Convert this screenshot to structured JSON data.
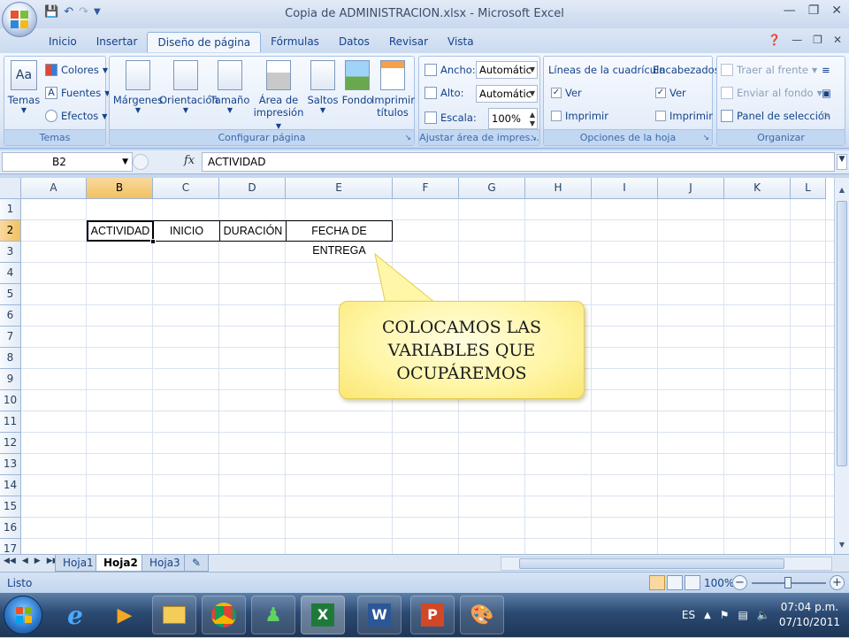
{
  "window": {
    "title": "Copia de ADMINISTRACION.xlsx - Microsoft Excel"
  },
  "ribbon_tabs": [
    "Inicio",
    "Insertar",
    "Diseño de página",
    "Fórmulas",
    "Datos",
    "Revisar",
    "Vista"
  ],
  "active_tab": "Diseño de página",
  "groups": {
    "temas": {
      "label": "Temas",
      "big_button": "Temas",
      "colores": "Colores",
      "fuentes": "Fuentes",
      "efectos": "Efectos"
    },
    "configurar": {
      "label": "Configurar página",
      "margenes": "Márgenes",
      "orientacion": "Orientación",
      "tamano": "Tamaño",
      "area_1": "Área de",
      "area_2": "impresión",
      "saltos": "Saltos",
      "fondo": "Fondo",
      "imprimir_1": "Imprimir",
      "imprimir_2": "títulos"
    },
    "ajustar": {
      "label": "Ajustar área de impres...",
      "ancho_label": "Ancho:",
      "ancho_value": "Automátic",
      "alto_label": "Alto:",
      "alto_value": "Automátic",
      "escala_label": "Escala:",
      "escala_value": "100%"
    },
    "opciones": {
      "label": "Opciones de la hoja",
      "lineas": "Líneas de la cuadrícula",
      "encabezados": "Encabezados",
      "ver": "Ver",
      "imprimir": "Imprimir"
    },
    "organizar": {
      "label": "Organizar",
      "traer": "Traer al frente",
      "enviar": "Enviar al fondo",
      "panel": "Panel de selección"
    }
  },
  "formula_bar": {
    "name_box": "B2",
    "fx": "fx",
    "content": "ACTIVIDAD"
  },
  "grid": {
    "columns": [
      "A",
      "B",
      "C",
      "D",
      "E",
      "F",
      "G",
      "H",
      "I",
      "J",
      "K",
      "L"
    ],
    "rows": [
      "1",
      "2",
      "3",
      "4",
      "5",
      "6",
      "7",
      "8",
      "9",
      "10",
      "11",
      "12",
      "13",
      "14",
      "15",
      "16",
      "17"
    ],
    "selected_column": "B",
    "selected_row": "2",
    "row2_cells": [
      "ACTIVIDAD",
      "INICIO",
      "DURACIÓN",
      "FECHA DE ENTREGA"
    ]
  },
  "callout": {
    "line1": "COLOCAMOS LAS",
    "line2": "VARIABLES QUE",
    "line3": "OCUPÁREMOS"
  },
  "sheets": [
    "Hoja1",
    "Hoja2",
    "Hoja3"
  ],
  "active_sheet": "Hoja2",
  "status": {
    "text": "Listo",
    "zoom": "100%"
  },
  "taskbar": {
    "language": "ES",
    "time": "07:04 p.m.",
    "date": "07/10/2011"
  }
}
